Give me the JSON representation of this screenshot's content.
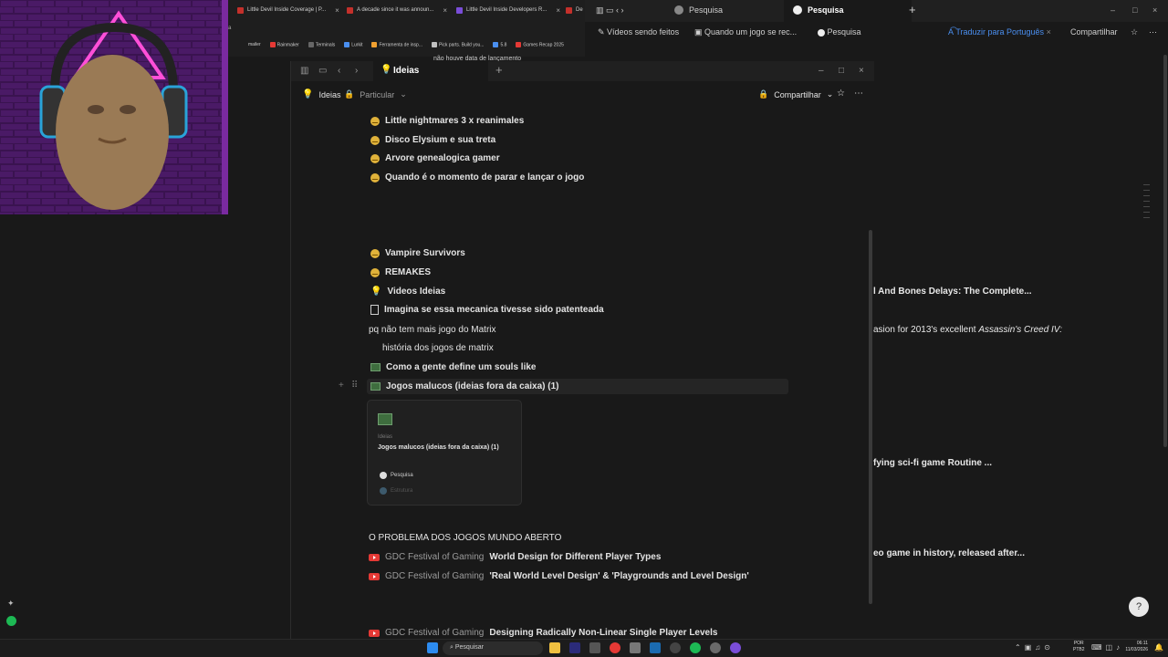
{
  "bg_browser": {
    "tabs": [
      "Little Devil Inside Coverage | P...",
      "A decade since it was announ...",
      "Little Devil Inside Developers R...",
      "De"
    ],
    "bookmarks": [
      "mailer",
      "Rainmaker",
      "Terminals",
      "Lurkit",
      "Ferramenta de insp...",
      "Pick parts. Build you...",
      "5.8",
      "Games Recap 2025"
    ],
    "partial_text": "não houve data de lançamento"
  },
  "bg_notion": {
    "tabs": [
      "Pesquisa",
      "Pesquisa"
    ],
    "breadcrumbs": [
      "Vídeos sendo feitos",
      "Quando um jogo se rec...",
      "Pesquisa"
    ],
    "translate_label": "Traduzir para Português",
    "share_label": "Compartilhar",
    "lines": [
      "l And Bones Delays: The Complete...",
      "asion for 2013's excellent ",
      "Assassin's Creed IV:",
      "fying sci-fi game Routine ...",
      "eo game in history, released after..."
    ]
  },
  "main": {
    "tab_title": "Ideias",
    "breadcrumb_title": "Ideias",
    "privacy": "Particular",
    "share_label": "Compartilhar",
    "items_top": [
      "Little nightmares 3 x reanimales",
      "Disco Elysium e sua treta",
      "Arvore genealogica gamer",
      "Quando é o momento de parar e lançar o jogo"
    ],
    "items_mid": {
      "vampire": "Vampire Survivors",
      "remakes": "REMAKES",
      "videos": "Videos Ideias",
      "imagina": "Imagina se essa mecanica tivesse sido patenteada",
      "matrix": "pq não tem mais jogo do Matrix",
      "matrix_sub": "história dos jogos de matrix",
      "souls": "Como a gente define um souls like",
      "malucos": "Jogos malucos (ideias fora da caixa) (1)"
    },
    "preview": {
      "parent": "Ideias",
      "title": "Jogos malucos (ideias fora da caixa) (1)",
      "item1": "Pesquisa",
      "item2": "Estrutura"
    },
    "open_world_heading": "O PROBLEMA DOS JOGOS MUNDO ABERTO",
    "yt_items": [
      {
        "source": "GDC Festival of Gaming",
        "title": "World Design for Different Player Types"
      },
      {
        "source": "GDC Festival of Gaming",
        "title": "'Real World Level Design' & 'Playgrounds and Level Design'"
      },
      {
        "source": "GDC Festival of Gaming",
        "title": "Designing Radically Non-Linear Single Player Levels"
      }
    ]
  },
  "taskbar": {
    "search_placeholder": "Pesquisar",
    "lang_top": "POR",
    "lang_bottom": "PTB2",
    "time": "06:11",
    "date": "11/03/2026"
  },
  "colors": {
    "background": "#191919",
    "accent_blue": "#4a8ff0",
    "youtube_red": "#e53935"
  }
}
